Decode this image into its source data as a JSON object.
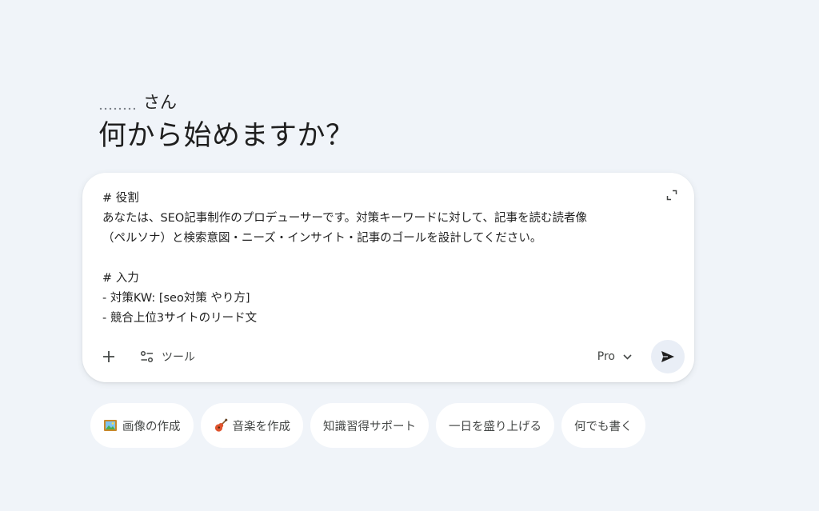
{
  "greeting": {
    "suffix": "さん",
    "headline": "何から始めますか？"
  },
  "prompt": {
    "lines": [
      "# 役割",
      "あなたは、SEO記事制作のプロデューサーです。対策キーワードに対して、記事を読む読者像",
      "（ペルソナ）と検索意図・ニーズ・インサイト・記事のゴールを設計してください。",
      "",
      "# 入力",
      "- 対策KW: [seo対策 やり方]",
      "- 競合上位3サイトのリード文"
    ]
  },
  "toolbar": {
    "tools_label": "ツール",
    "model_label": "Pro"
  },
  "chips": [
    {
      "label": "画像の作成",
      "icon": "picture-frame-icon"
    },
    {
      "label": "音楽を作成",
      "icon": "guitar-icon"
    },
    {
      "label": "知識習得サポート"
    },
    {
      "label": "一日を盛り上げる"
    },
    {
      "label": "何でも書く"
    }
  ],
  "colors": {
    "background": "#f0f4f9",
    "card": "#ffffff",
    "text": "#1f1f1f",
    "muted": "#444746",
    "send_bg": "#e9eef6"
  }
}
